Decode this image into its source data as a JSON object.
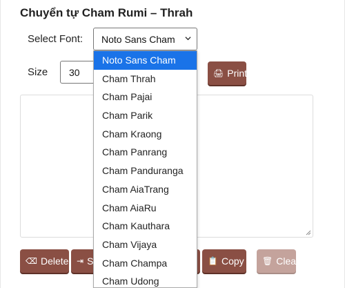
{
  "title": "Chuyển tự Cham Rumi – Thrah",
  "labels": {
    "select_font": "Select Font:",
    "size": "Size"
  },
  "font_select": {
    "value": "Noto Sans Cham"
  },
  "size_select": {
    "value": "30"
  },
  "dropdown": {
    "options": [
      "Noto Sans Cham",
      "Cham Thrah",
      "Cham Pajai",
      "Cham Parik",
      "Cham Kraong",
      "Cham Panrang",
      "Cham Panduranga",
      "Cham AiaTrang",
      "Cham AiaRu",
      "Cham Kauthara",
      "Cham Vijaya",
      "Cham Champa",
      "Cham Udong"
    ],
    "selected_index": 0
  },
  "buttons": {
    "print": "Print",
    "delete": "Delete",
    "s_partial": "S",
    "copy": "Copy",
    "clear": "Clear"
  },
  "icons": {
    "print": "printer-icon",
    "delete": "backspace-icon",
    "s": "arrow-to-right-icon",
    "copy": "clipboard-icon",
    "clear": "trash-icon"
  },
  "colors": {
    "button": "#8a4f44",
    "button_disabled": "#c4a39c",
    "highlight": "#1a73e8"
  }
}
